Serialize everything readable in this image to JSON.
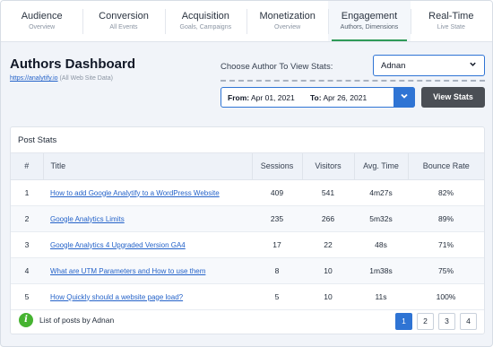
{
  "tabs": [
    {
      "label": "Audience",
      "sub": "Overview"
    },
    {
      "label": "Conversion",
      "sub": "All Events"
    },
    {
      "label": "Acquisition",
      "sub": "Goals, Campaigns"
    },
    {
      "label": "Monetization",
      "sub": "Overview"
    },
    {
      "label": "Engagement",
      "sub": "Authors, Dimensions"
    },
    {
      "label": "Real-Time",
      "sub": "Live State"
    }
  ],
  "header": {
    "title": "Authors Dashboard",
    "site_link": "https://analytify.io",
    "site_note": "(All Web Site Data)",
    "author_label": "Choose Author To View Stats:",
    "author_selected": "Adnan",
    "from_label": "From:",
    "from_date": "Apr 01, 2021",
    "to_label": "To:",
    "to_date": "Apr 26, 2021",
    "view_button": "View Stats"
  },
  "card": {
    "title": "Post Stats",
    "columns": {
      "num": "#",
      "title": "Title",
      "sessions": "Sessions",
      "visitors": "Visitors",
      "avg_time": "Avg. Time",
      "bounce": "Bounce Rate"
    },
    "rows": [
      {
        "num": "1",
        "title": "How to add Google Analytify to a WordPress Website",
        "sessions": "409",
        "visitors": "541",
        "avg_time": "4m27s",
        "bounce": "82%"
      },
      {
        "num": "2",
        "title": "Google Analytics Limits",
        "sessions": "235",
        "visitors": "266",
        "avg_time": "5m32s",
        "bounce": "89%"
      },
      {
        "num": "3",
        "title": "Google Analytics 4 Upgraded Version GA4",
        "sessions": "17",
        "visitors": "22",
        "avg_time": "48s",
        "bounce": "71%"
      },
      {
        "num": "4",
        "title": "What are UTM Parameters and How to use them",
        "sessions": "8",
        "visitors": "10",
        "avg_time": "1m38s",
        "bounce": "75%"
      },
      {
        "num": "5",
        "title": "How Quickly should a website page load?",
        "sessions": "5",
        "visitors": "10",
        "avg_time": "11s",
        "bounce": "100%"
      }
    ],
    "footer_text": "List of posts by Adnan",
    "pages": [
      "1",
      "2",
      "3",
      "4"
    ],
    "active_page": "1"
  },
  "colors": {
    "accent": "#2f74d4",
    "active_tab_underline": "#2f9a58",
    "info_icon": "#46b331",
    "view_button": "#4b4f55"
  },
  "icons": {
    "select": "chevron-down-icon",
    "date": "chevron-down-icon",
    "info": "info-icon"
  }
}
